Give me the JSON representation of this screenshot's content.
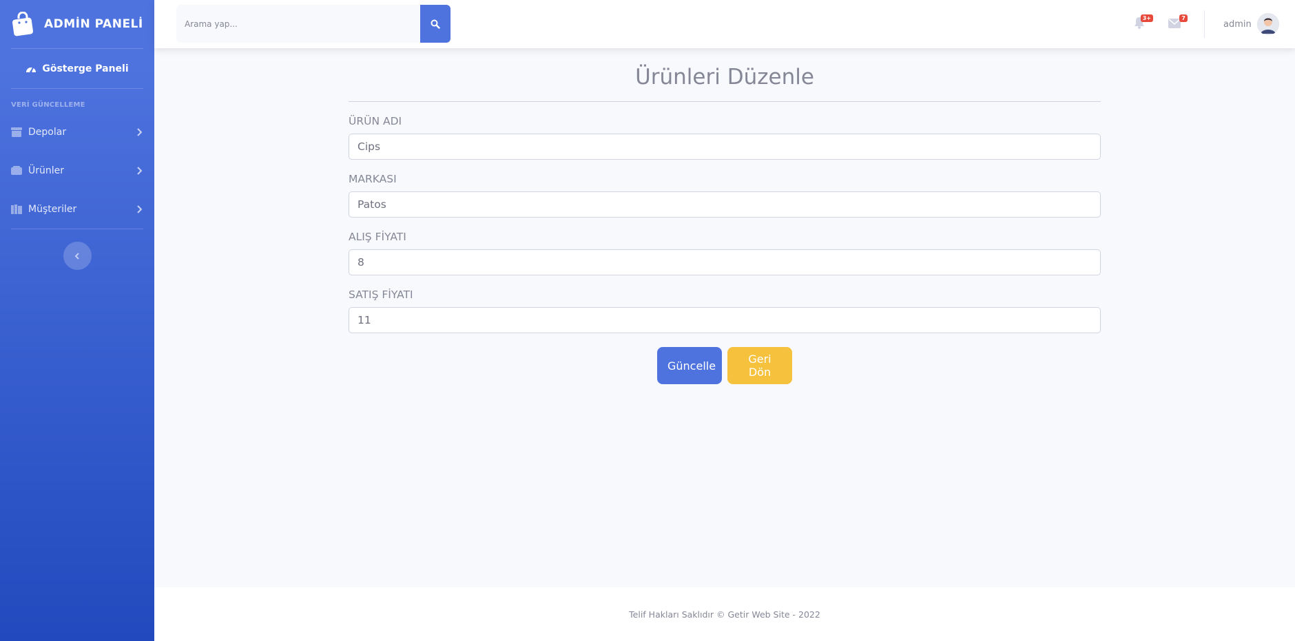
{
  "sidebar": {
    "brand": "ADMİN PANELİ",
    "dashboard": "Gösterge Paneli",
    "heading": "VERİ GÜNCELLEME",
    "items": [
      {
        "label": "Depolar",
        "icon": "warehouse-icon"
      },
      {
        "label": "Ürünler",
        "icon": "box-icon"
      },
      {
        "label": "Müşteriler",
        "icon": "address-book-icon"
      }
    ]
  },
  "topbar": {
    "search_placeholder": "Arama yap...",
    "alerts_badge": "3+",
    "messages_badge": "7",
    "user_name": "admin"
  },
  "form": {
    "title": "Ürünleri Düzenle",
    "fields": [
      {
        "label": "ÜRÜN ADI",
        "value": "Cips"
      },
      {
        "label": "MARKASI",
        "value": "Patos"
      },
      {
        "label": "ALIŞ FİYATI",
        "value": "8"
      },
      {
        "label": "SATIŞ FİYATI",
        "value": "11"
      }
    ],
    "update_label": "Güncelle",
    "back_label": "Geri Dön"
  },
  "footer": {
    "copyright": "Telif Hakları Saklıdır © Getir Web Site - 2022"
  },
  "colors": {
    "primary": "#4e73df",
    "warning": "#f6c23e",
    "danger": "#e74a3b",
    "background": "#f8f9fc"
  }
}
